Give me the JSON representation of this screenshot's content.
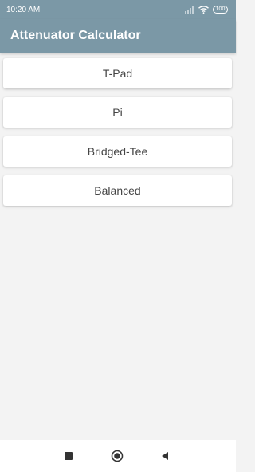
{
  "status_bar": {
    "time": "10:20 AM",
    "battery_level": "100",
    "icons": [
      "signal-icon",
      "wifi-icon",
      "battery-icon"
    ]
  },
  "app_bar": {
    "title": "Attenuator Calculator"
  },
  "menu": {
    "items": [
      {
        "label": "T-Pad"
      },
      {
        "label": "Pi"
      },
      {
        "label": "Bridged-Tee"
      },
      {
        "label": "Balanced"
      }
    ]
  },
  "nav_bar": {
    "icons": [
      "recent-apps-icon",
      "home-icon",
      "back-icon"
    ]
  },
  "colors": {
    "app_bar": "#7b98a6",
    "background": "#f3f3f3",
    "button": "#ffffff",
    "button_text": "#454545"
  }
}
